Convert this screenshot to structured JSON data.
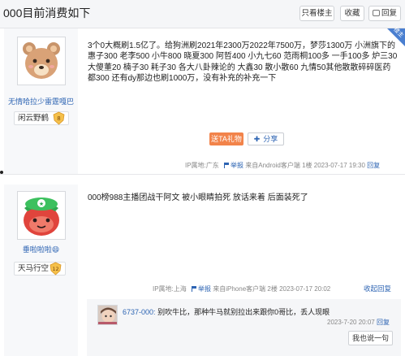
{
  "thread": {
    "title": "000目前消费如下",
    "buttons": {
      "only_op": "只看楼主",
      "favorite": "收藏",
      "reply": "回复"
    }
  },
  "post1": {
    "corner_tag": "楼主",
    "user": {
      "name": "无情哈拉少雷霆嘎巴",
      "badge": "闲云野鹤",
      "level": "8"
    },
    "content": "3个0大概刷1.5亿了。给狗洲刷2021年2300万2022年7500万，梦莎1300万 小洲旗下的惠子300 老李500 小牛800 晓夏300 阿哲400 小九七60 范雨桐100多 一手100多 炉三30 大傻董20 楠子30 耗子30 各大八卦辣论的 大鑫30 散小散60 九情50其他散散碎碎医药都300 还有dy那边也刷1000万，没有补充的补充一下",
    "gift_button": "送TA礼物",
    "share_button": "分享",
    "meta": {
      "ip": "IP属地:广东",
      "report": "举报",
      "source": "来自Android客户端",
      "floor": "1楼",
      "time": "2023-07-17 19:30",
      "reply": "回复"
    }
  },
  "post2": {
    "user": {
      "name": "垂啦啦啦😄",
      "badge": "天马行空",
      "level": "12"
    },
    "content": "000榜988主播团战干阿文 被小眼睛拍死 放话来着 后面装死了",
    "meta": {
      "ip": "IP属地:上海",
      "report": "举报",
      "source": "来自iPhone客户端",
      "floor": "2楼",
      "time": "2023-07-17 20:02",
      "collapse": "收起回复"
    },
    "sub_reply": {
      "user": "6737-000:",
      "text": "别吹牛比，那种牛马就别拉出来跟你0哥比，丢人现眼",
      "time": "2023-7-20 20:07",
      "reply": "回复",
      "say_button": "我也说一句"
    }
  },
  "colors": {
    "link": "#2d64b3",
    "gift": "#f2834a",
    "corner": "#4a7fd0"
  }
}
